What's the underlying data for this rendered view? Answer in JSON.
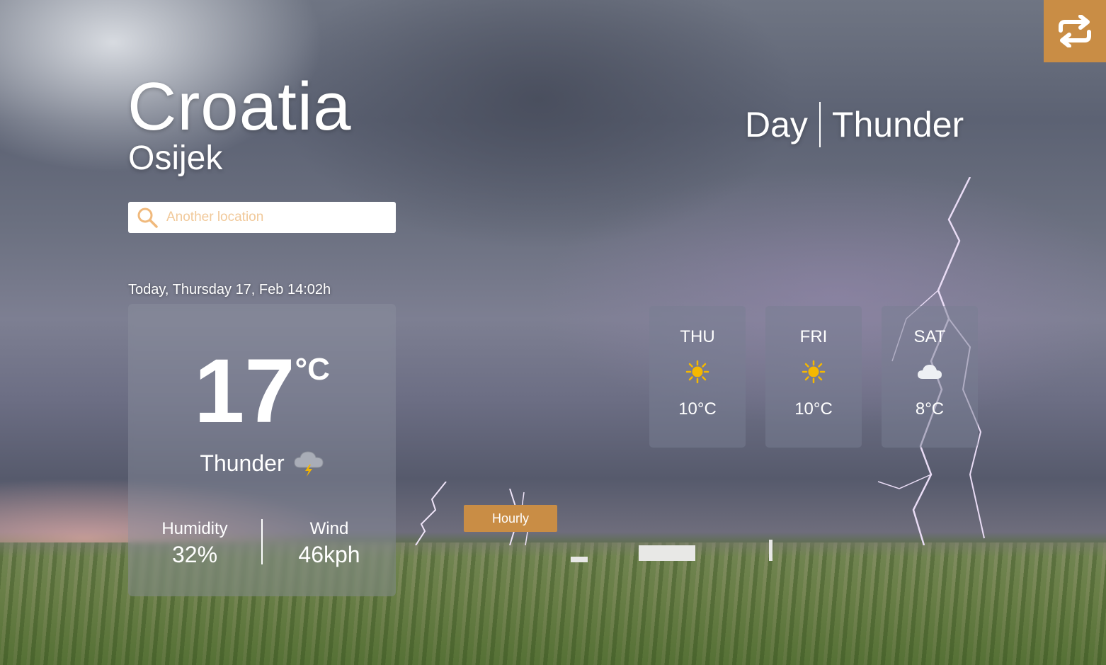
{
  "location": {
    "country": "Croatia",
    "city": "Osijek"
  },
  "search": {
    "placeholder": "Another location"
  },
  "today": {
    "date_text": "Today, Thursday 17, Feb 14:02h",
    "temperature": "17",
    "unit": "°C",
    "condition": "Thunder",
    "condition_icon": "thunder-cloud-icon",
    "humidity_label": "Humidity",
    "humidity_value": "32%",
    "wind_label": "Wind",
    "wind_value": "46kph"
  },
  "header": {
    "period": "Day",
    "summary": "Thunder",
    "swap_icon": "swap-arrows-icon"
  },
  "forecast": [
    {
      "day": "THU",
      "icon": "sun-icon",
      "temp": "10°C"
    },
    {
      "day": "FRI",
      "icon": "sun-icon",
      "temp": "10°C"
    },
    {
      "day": "SAT",
      "icon": "cloud-icon",
      "temp": "8°C"
    }
  ],
  "buttons": {
    "hourly_label": "Hourly"
  },
  "colors": {
    "accent": "#c98d45",
    "search_placeholder": "#f1c99a"
  }
}
